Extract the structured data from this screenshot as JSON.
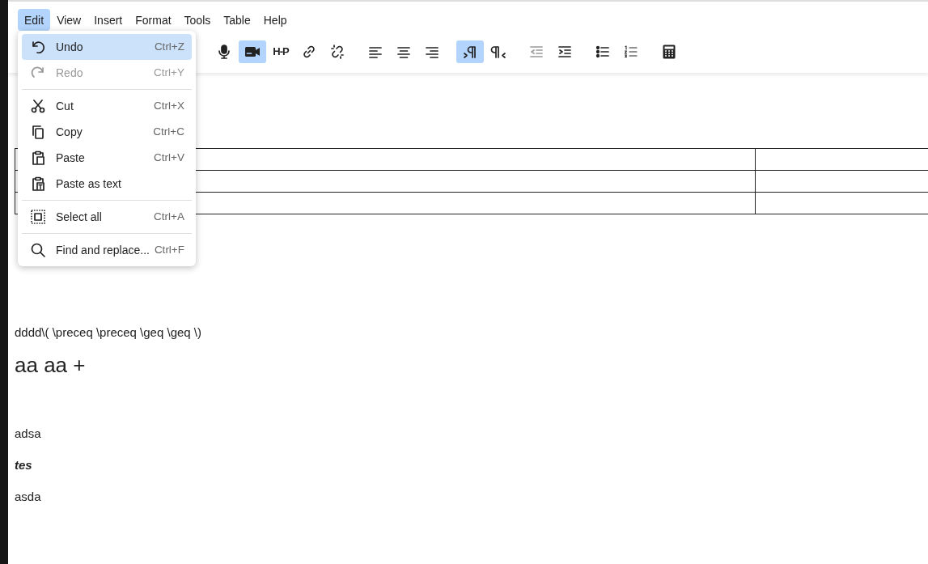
{
  "menubar": [
    {
      "label": "Edit",
      "selected": true
    },
    {
      "label": "View",
      "selected": false
    },
    {
      "label": "Insert",
      "selected": false
    },
    {
      "label": "Format",
      "selected": false
    },
    {
      "label": "Tools",
      "selected": false
    },
    {
      "label": "Table",
      "selected": false
    },
    {
      "label": "Help",
      "selected": false
    }
  ],
  "toolbar": [
    {
      "kind": "mic",
      "selected": false,
      "disabled": false
    },
    {
      "kind": "video",
      "selected": true,
      "disabled": false
    },
    {
      "kind": "h5p",
      "label": "H-P",
      "selected": false,
      "disabled": false
    },
    {
      "kind": "link",
      "selected": false,
      "disabled": false
    },
    {
      "kind": "unlink",
      "selected": false,
      "disabled": false
    },
    {
      "kind": "sep"
    },
    {
      "kind": "align-left",
      "selected": false,
      "disabled": false
    },
    {
      "kind": "align-center",
      "selected": false,
      "disabled": false
    },
    {
      "kind": "align-right",
      "selected": false,
      "disabled": false
    },
    {
      "kind": "sep"
    },
    {
      "kind": "ltr",
      "selected": true,
      "disabled": false
    },
    {
      "kind": "rtl",
      "selected": false,
      "disabled": false
    },
    {
      "kind": "sep"
    },
    {
      "kind": "outdent",
      "selected": false,
      "disabled": true
    },
    {
      "kind": "indent",
      "selected": false,
      "disabled": false
    },
    {
      "kind": "sep"
    },
    {
      "kind": "bullets",
      "selected": false,
      "disabled": false
    },
    {
      "kind": "numbers",
      "selected": false,
      "disabled": false
    },
    {
      "kind": "sep"
    },
    {
      "kind": "calculator",
      "selected": false,
      "disabled": false
    }
  ],
  "edit_menu": [
    {
      "kind": "undo",
      "label": "Undo",
      "shortcut": "Ctrl+Z",
      "selected": true,
      "disabled": false
    },
    {
      "kind": "redo",
      "label": "Redo",
      "shortcut": "Ctrl+Y",
      "selected": false,
      "disabled": true
    },
    {
      "kind": "separator"
    },
    {
      "kind": "cut",
      "label": "Cut",
      "shortcut": "Ctrl+X",
      "selected": false,
      "disabled": false
    },
    {
      "kind": "copy",
      "label": "Copy",
      "shortcut": "Ctrl+C",
      "selected": false,
      "disabled": false
    },
    {
      "kind": "paste",
      "label": "Paste",
      "shortcut": "Ctrl+V",
      "selected": false,
      "disabled": false
    },
    {
      "kind": "paste-text",
      "label": "Paste as text",
      "selected": false,
      "disabled": false
    },
    {
      "kind": "separator"
    },
    {
      "kind": "select-all",
      "label": "Select all",
      "shortcut": "Ctrl+A",
      "selected": false,
      "disabled": false
    },
    {
      "kind": "separator"
    },
    {
      "kind": "search",
      "label": "Find and replace...",
      "shortcut": "Ctrl+F",
      "selected": false,
      "disabled": false
    }
  ],
  "content": [
    {
      "kind": "blank"
    },
    {
      "kind": "blank"
    },
    {
      "kind": "table"
    },
    {
      "kind": "blank"
    },
    {
      "kind": "blank"
    },
    {
      "kind": "blank"
    },
    {
      "kind": "paragraph",
      "text": "dddd\\( \\preceq \\preceq \\geq \\geq \\)"
    },
    {
      "kind": "heading",
      "text": "aa aa +"
    },
    {
      "kind": "blank"
    },
    {
      "kind": "paragraph",
      "text": "adsa"
    },
    {
      "kind": "emphasis",
      "text": "tes"
    },
    {
      "kind": "paragraph",
      "text": "asda"
    }
  ]
}
